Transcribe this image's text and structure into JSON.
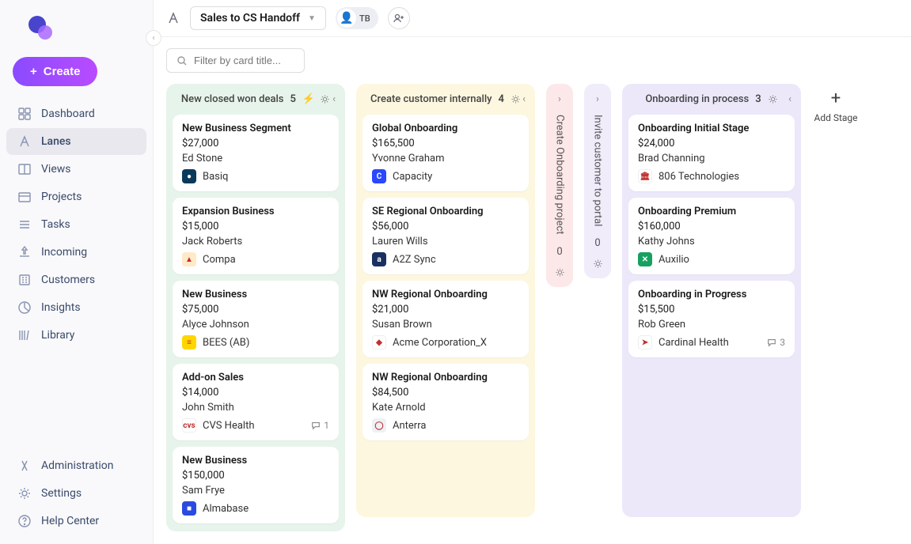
{
  "sidebar": {
    "create_label": "Create",
    "items": [
      {
        "label": "Dashboard"
      },
      {
        "label": "Lanes"
      },
      {
        "label": "Views"
      },
      {
        "label": "Projects"
      },
      {
        "label": "Tasks"
      },
      {
        "label": "Incoming"
      },
      {
        "label": "Customers"
      },
      {
        "label": "Insights"
      },
      {
        "label": "Library"
      }
    ],
    "footer": [
      {
        "label": "Administration"
      },
      {
        "label": "Settings"
      },
      {
        "label": "Help Center"
      }
    ]
  },
  "header": {
    "lane_name": "Sales to CS Handoff",
    "user_initials": "TB"
  },
  "filter": {
    "placeholder": "Filter by card title..."
  },
  "columns": [
    {
      "title": "New closed won deals",
      "count": "5",
      "cards": [
        {
          "title": "New Business Segment",
          "amount": "$27,000",
          "person": "Ed Stone",
          "company": "Basiq",
          "icon_bg": "#0a3a5a",
          "icon_txt": "●"
        },
        {
          "title": "Expansion Business",
          "amount": "$15,000",
          "person": "Jack Roberts",
          "company": "Compa",
          "icon_bg": "#ffe9c7",
          "icon_txt": "▲"
        },
        {
          "title": "New Business",
          "amount": "$75,000",
          "person": "Alyce Johnson",
          "company": "BEES (AB)",
          "icon_bg": "#ffd600",
          "icon_txt": "≡"
        },
        {
          "title": "Add-on Sales",
          "amount": "$14,000",
          "person": "John Smith",
          "company": "CVS Health",
          "icon_bg": "#ffffff",
          "icon_txt": "cvs",
          "comments": "1"
        },
        {
          "title": "New Business",
          "amount": "$150,000",
          "person": "Sam Frye",
          "company": "Almabase",
          "icon_bg": "#2a4be0",
          "icon_txt": "■"
        }
      ]
    },
    {
      "title": "Create customer internally",
      "count": "4",
      "cards": [
        {
          "title": "Global Onboarding",
          "amount": "$165,500",
          "person": "Yvonne Graham",
          "company": "Capacity",
          "icon_bg": "#2948ff",
          "icon_txt": "C"
        },
        {
          "title": "SE Regional Onboarding",
          "amount": "$56,000",
          "person": "Lauren Wills",
          "company": "A2Z Sync",
          "icon_bg": "#1a3060",
          "icon_txt": "a"
        },
        {
          "title": "NW Regional Onboarding",
          "amount": "$21,000",
          "person": "Susan Brown",
          "company": "Acme Corporation_X",
          "icon_bg": "#ffffff",
          "icon_txt": "◆"
        },
        {
          "title": "NW Regional Onboarding",
          "amount": "$84,500",
          "person": "Kate Arnold",
          "company": "Anterra",
          "icon_bg": "#eef1f4",
          "icon_txt": "◯"
        }
      ]
    },
    {
      "title": "Create Onboarding project",
      "count": "0",
      "collapsed": true
    },
    {
      "title": "Invite customer to portal",
      "count": "0",
      "collapsed": true
    },
    {
      "title": "Onboarding in process",
      "count": "3",
      "cards": [
        {
          "title": "Onboarding Initial Stage",
          "amount": "$24,000",
          "person": "Brad Channing",
          "company": "806 Technologies",
          "icon_bg": "#ffffff",
          "icon_txt": "🏛"
        },
        {
          "title": "Onboarding Premium",
          "amount": "$160,000",
          "person": "Kathy Johns",
          "company": "Auxilio",
          "icon_bg": "#18a060",
          "icon_txt": "✕"
        },
        {
          "title": "Onboarding in Progress",
          "amount": "$15,500",
          "person": "Rob Green",
          "company": "Cardinal Health",
          "icon_bg": "#ffffff",
          "icon_txt": "➤",
          "comments": "3"
        }
      ]
    }
  ],
  "add_stage_label": "Add Stage"
}
